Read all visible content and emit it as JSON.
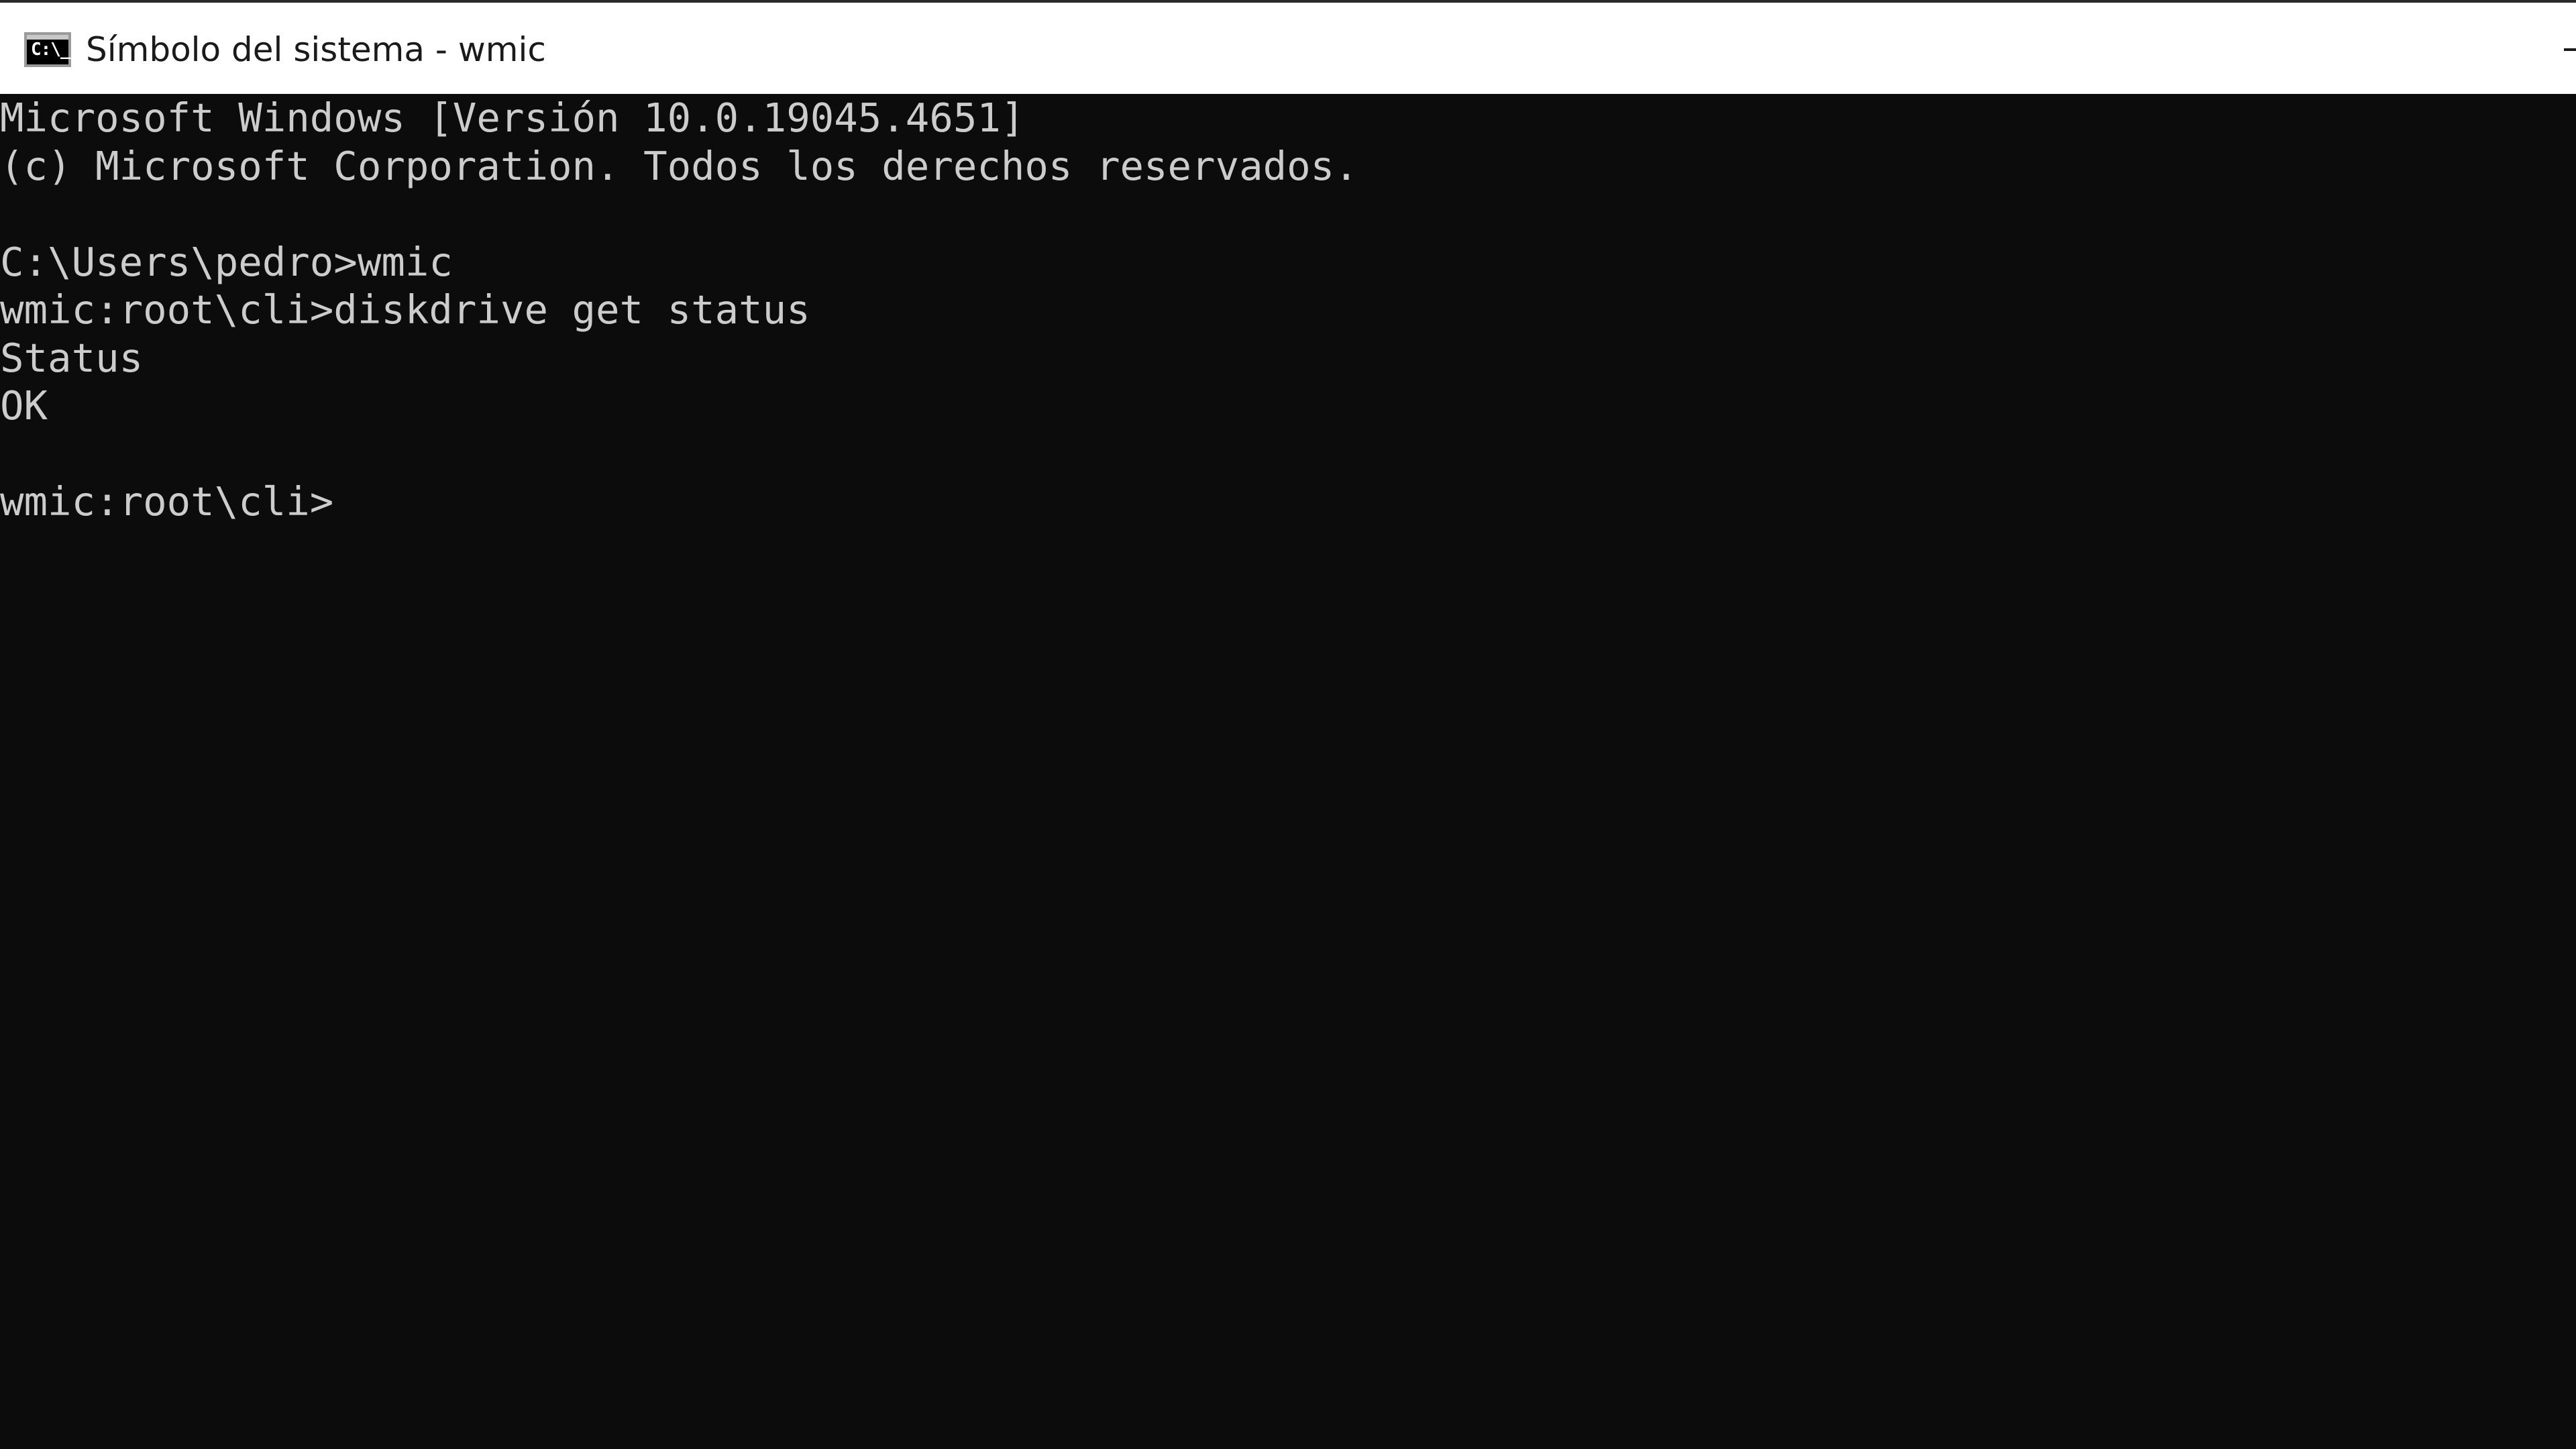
{
  "window": {
    "title": "Símbolo del sistema - wmic",
    "icon_text": "C:\\_",
    "icon": "command-prompt-icon"
  },
  "console": {
    "lines": [
      "Microsoft Windows [Versión 10.0.19045.4651]",
      "(c) Microsoft Corporation. Todos los derechos reservados.",
      "",
      "C:\\Users\\pedro>wmic",
      "wmic:root\\cli>diskdrive get status",
      "Status",
      "OK",
      "",
      "wmic:root\\cli>"
    ]
  },
  "colors": {
    "console_background": "#0c0c0c",
    "console_text": "#cccccc",
    "titlebar_background": "#ffffff",
    "titlebar_text": "#1a1a1a"
  }
}
